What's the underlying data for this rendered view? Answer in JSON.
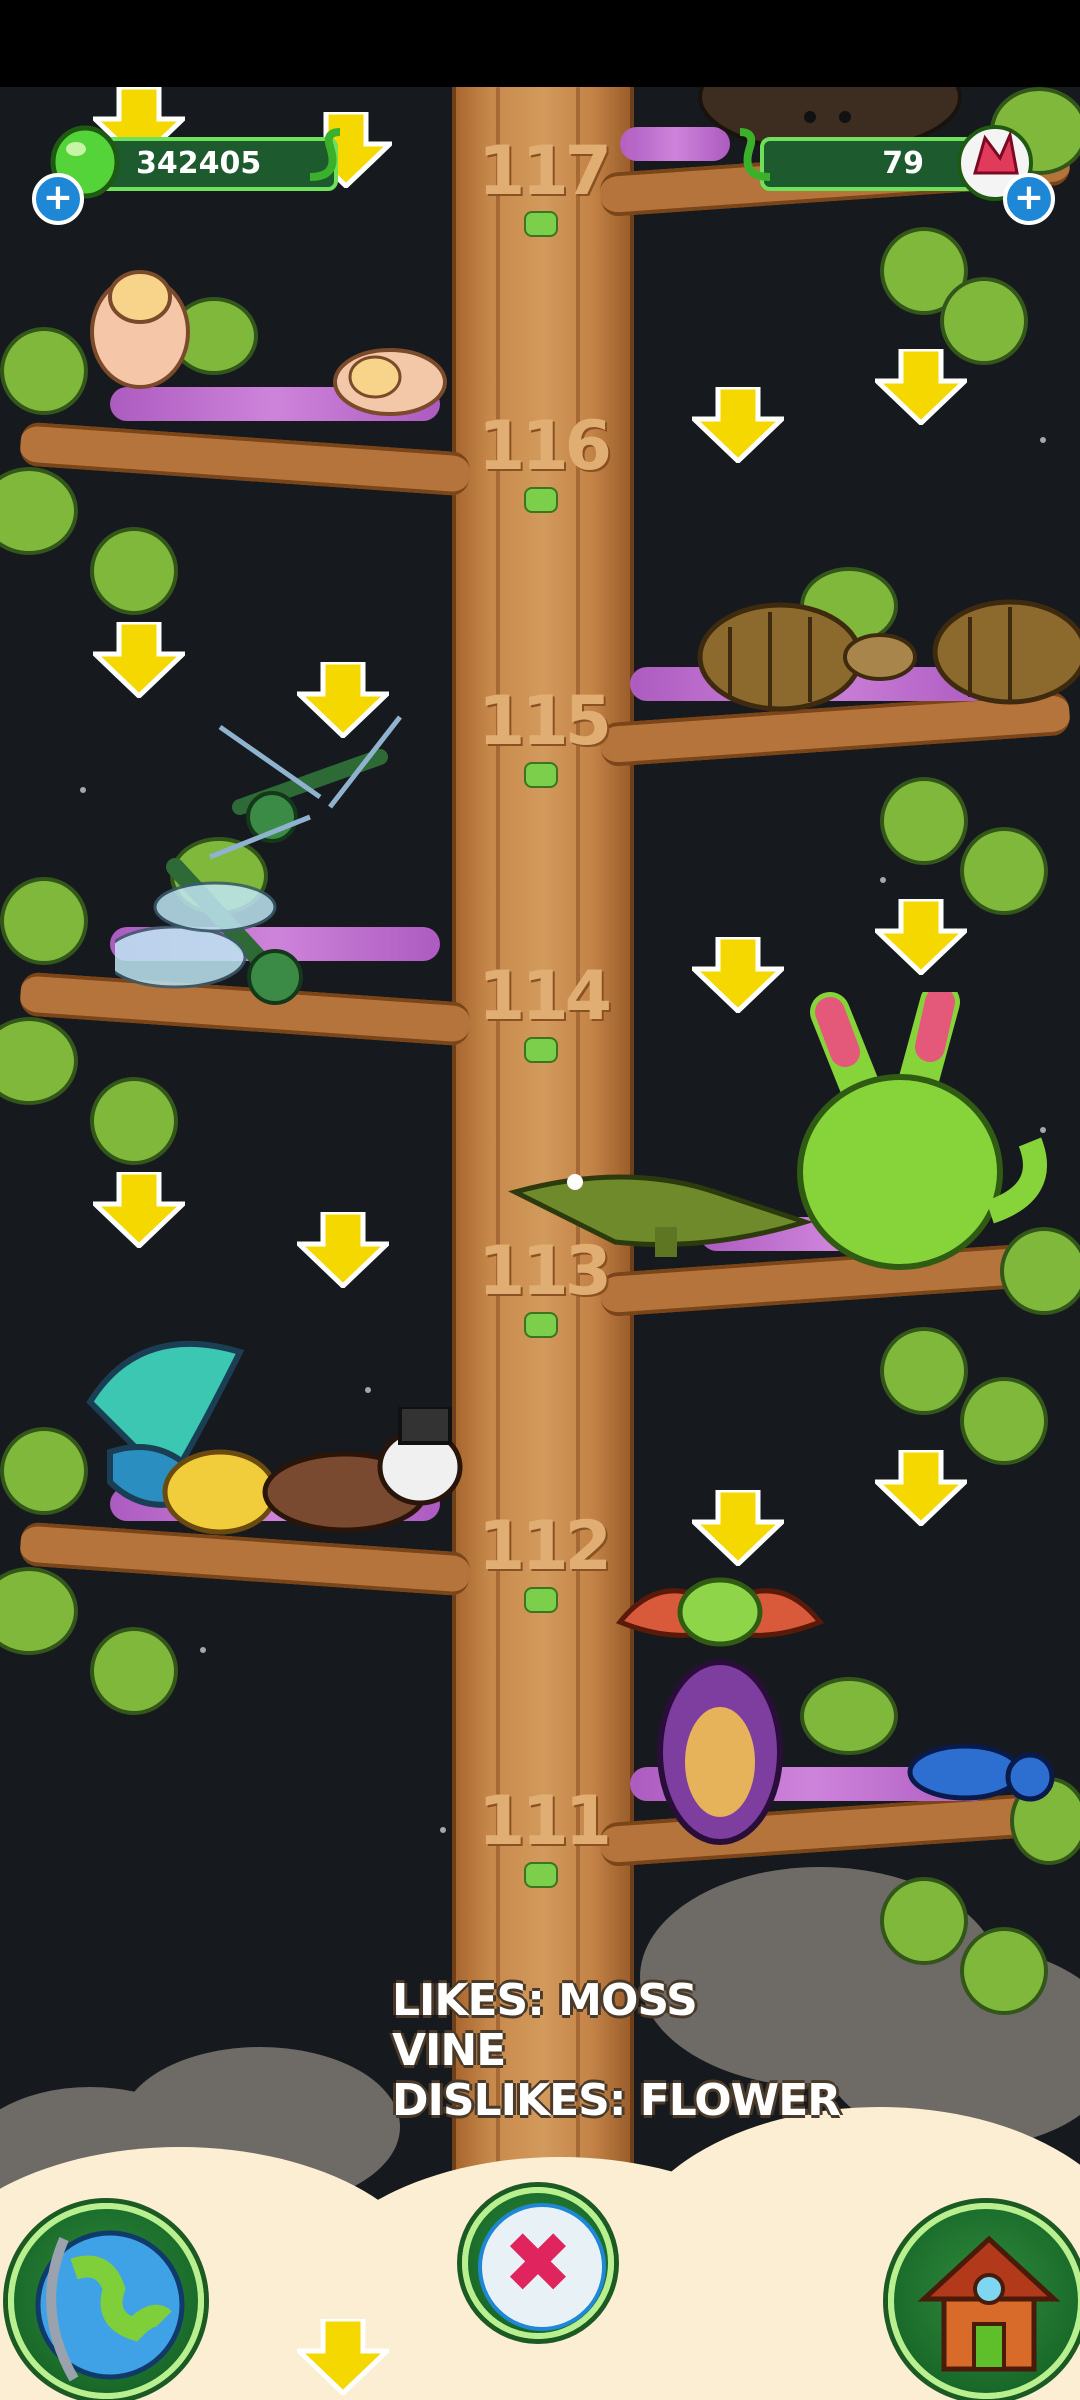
{
  "hud": {
    "gems_count": "342405",
    "crystals_count": "79",
    "plus_symbol": "+"
  },
  "tree": {
    "levels": [
      "117",
      "116",
      "115",
      "114",
      "113",
      "112",
      "111"
    ]
  },
  "info": {
    "line1": "LIKES: MOSS",
    "line2": "VINE",
    "line3": "DISLIKES: FLOWER"
  },
  "buttons": {
    "close_symbol": "✖"
  },
  "colors": {
    "arrow": "#f5d800",
    "moss": "#c46fd6",
    "hud_green": "#6fe05a",
    "close_red": "#e0245e"
  }
}
